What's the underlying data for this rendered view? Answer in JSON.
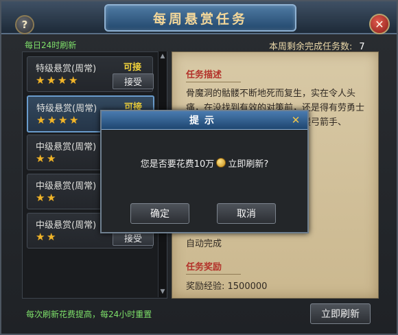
{
  "window": {
    "title": "每周悬赏任务",
    "help_glyph": "?",
    "close_glyph": "✕"
  },
  "header": {
    "refresh_info": "每日24时刷新",
    "remaining_label": "本周剩余完成任务数:",
    "remaining_count": "7"
  },
  "tasks": [
    {
      "name": "特级悬赏(周常)",
      "status": "可接",
      "stars": 4,
      "accept_label": "接受"
    },
    {
      "name": "特级悬赏(周常)",
      "status": "可接",
      "stars": 4,
      "accept_label": "接受"
    },
    {
      "name": "中级悬赏(周常)",
      "status": "",
      "stars": 2,
      "accept_label": "接受"
    },
    {
      "name": "中级悬赏(周常)",
      "status": "",
      "stars": 2,
      "accept_label": "接受"
    },
    {
      "name": "中级悬赏(周常)",
      "status": "",
      "stars": 2,
      "accept_label": "接受"
    }
  ],
  "detail": {
    "desc_title": "任务描述",
    "desc_text": "骨魔洞的骷髅不断地死而复生，实在令人头痛，在没找到有效的对策前，还是得有劳勇士们帮忙。请前往骨魔洞击杀骷髅弓箭手、",
    "complete_text": "自动完成",
    "reward_title": "任务奖励",
    "reward_text": "奖励经验: 1500000"
  },
  "footer": {
    "note": "每次刷新花费提高，每24小时重置",
    "refresh_button": "立即刷新"
  },
  "dialog": {
    "title": "提示",
    "close_glyph": "✕",
    "message_before": "您是否要花费10万",
    "message_after": "立即刷新?",
    "confirm_label": "确定",
    "cancel_label": "取消"
  },
  "colors": {
    "accent_green": "#7ee06a",
    "status_yellow": "#f2d33b",
    "star_gold": "#f0b52b",
    "section_red": "#b3322a"
  }
}
